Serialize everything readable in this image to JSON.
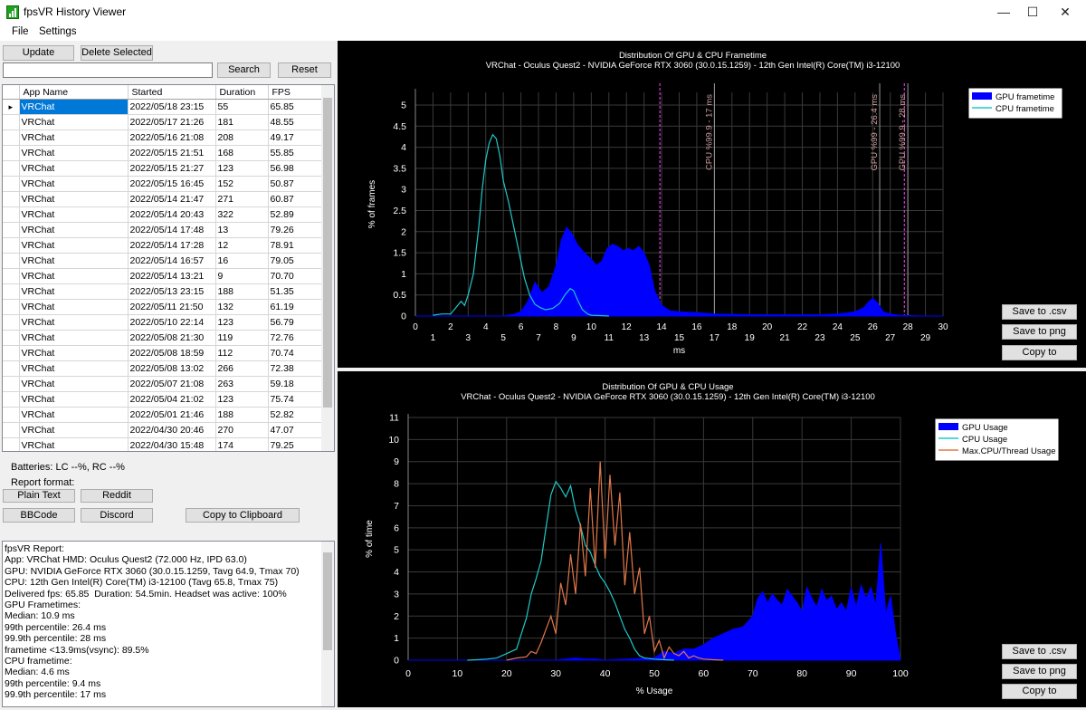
{
  "window": {
    "title": "fpsVR History Viewer",
    "minimize_glyph": "—",
    "maximize_glyph": "☐",
    "close_glyph": "✕"
  },
  "menu": [
    "File",
    "Settings"
  ],
  "toolbar": {
    "update": "Update",
    "delete_selected": "Delete Selected",
    "search": "Search",
    "reset": "Reset",
    "search_value": ""
  },
  "table": {
    "columns": [
      "App Name",
      "Started",
      "Duration",
      "FPS"
    ],
    "rows": [
      [
        "VRChat",
        "2022/05/18 23:15",
        "55",
        "65.85"
      ],
      [
        "VRChat",
        "2022/05/17 21:26",
        "181",
        "48.55"
      ],
      [
        "VRChat",
        "2022/05/16 21:08",
        "208",
        "49.17"
      ],
      [
        "VRChat",
        "2022/05/15 21:51",
        "168",
        "55.85"
      ],
      [
        "VRChat",
        "2022/05/15 21:27",
        "123",
        "56.98"
      ],
      [
        "VRChat",
        "2022/05/15 16:45",
        "152",
        "50.87"
      ],
      [
        "VRChat",
        "2022/05/14 21:47",
        "271",
        "60.87"
      ],
      [
        "VRChat",
        "2022/05/14 20:43",
        "322",
        "52.89"
      ],
      [
        "VRChat",
        "2022/05/14 17:48",
        "13",
        "79.26"
      ],
      [
        "VRChat",
        "2022/05/14 17:28",
        "12",
        "78.91"
      ],
      [
        "VRChat",
        "2022/05/14 16:57",
        "16",
        "79.05"
      ],
      [
        "VRChat",
        "2022/05/14 13:21",
        "9",
        "70.70"
      ],
      [
        "VRChat",
        "2022/05/13 23:15",
        "188",
        "51.35"
      ],
      [
        "VRChat",
        "2022/05/11 21:50",
        "132",
        "61.19"
      ],
      [
        "VRChat",
        "2022/05/10 22:14",
        "123",
        "56.79"
      ],
      [
        "VRChat",
        "2022/05/08 21:30",
        "119",
        "72.76"
      ],
      [
        "VRChat",
        "2022/05/08 18:59",
        "112",
        "70.74"
      ],
      [
        "VRChat",
        "2022/05/08 13:02",
        "266",
        "72.38"
      ],
      [
        "VRChat",
        "2022/05/07 21:08",
        "263",
        "59.18"
      ],
      [
        "VRChat",
        "2022/05/04 21:02",
        "123",
        "75.74"
      ],
      [
        "VRChat",
        "2022/05/01 21:46",
        "188",
        "52.82"
      ],
      [
        "VRChat",
        "2022/04/30 20:46",
        "270",
        "47.07"
      ],
      [
        "VRChat",
        "2022/04/30 15:48",
        "174",
        "79.25"
      ]
    ],
    "selected_row": 0,
    "row_pointer": "▸"
  },
  "batteries": "Batteries: LC --%, RC --%",
  "report_format": {
    "label": "Report format:",
    "plain_text": "Plain Text",
    "reddit": "Reddit",
    "bbcode": "BBCode",
    "discord": "Discord",
    "copy_to_clipboard": "Copy to Clipboard"
  },
  "report": [
    "fpsVR Report:",
    "App: VRChat HMD: Oculus Quest2 (72.000 Hz, IPD 63.0)",
    "GPU: NVIDIA GeForce RTX 3060 (30.0.15.1259, Tavg 64.9, Tmax 70) CPU: 12th Gen Intel(R) Core(TM) i3-12100 (Tavg 65.8, Tmax 75)",
    "Delivered fps: 65.85  Duration: 54.5min. Headset was active: 100%",
    "GPU Frametimes:",
    "Median: 10.9 ms",
    "99th percentile: 26.4 ms",
    "99.9th percentile: 28 ms",
    "frametime <13.9ms(vsync): 89.5%",
    "CPU frametime:",
    "Median: 4.6 ms",
    "99th percentile: 9.4 ms",
    "99.9th percentile: 17 ms"
  ],
  "side_buttons": {
    "save_csv": "Save to .csv",
    "save_png": "Save to png",
    "copy_to": "Copy to"
  },
  "colors": {
    "gpu": "#0000ff",
    "cpu": "#1fc9c9",
    "thread": "#e0784a",
    "marker_cpu": "#a0a0a0",
    "marker_gpu": "#9a9a9a",
    "marker_gpu999": "#ff33ff",
    "vsync": "#ff44ff",
    "selection": "#0078d7"
  },
  "chart_data": [
    {
      "type": "area",
      "title": "Distribution Of GPU & CPU Frametime",
      "subtitle": "VRChat - Oculus Quest2 - NVIDIA GeForce RTX 3060 (30.0.15.1259) - 12th Gen Intel(R) Core(TM) i3-12100",
      "xlabel": "ms",
      "ylabel": "% of frames",
      "xlim": [
        0,
        30
      ],
      "ylim": [
        0,
        5.3
      ],
      "x_ticks_top": [
        0,
        2,
        4,
        6,
        8,
        10,
        12,
        14,
        16,
        18,
        20,
        22,
        24,
        26,
        28,
        30
      ],
      "x_ticks_bottom": [
        1,
        3,
        5,
        7,
        9,
        11,
        13,
        15,
        17,
        19,
        21,
        23,
        25,
        27,
        29
      ],
      "y_ticks": [
        0,
        0.5,
        1,
        1.5,
        2,
        2.5,
        3,
        3.5,
        4,
        4.5,
        5
      ],
      "grid": true,
      "legend": "top-right",
      "series": [
        {
          "name": "GPU frametime",
          "style": "area",
          "x": [
            0,
            1,
            2,
            3,
            4,
            5,
            5.6,
            6,
            6.4,
            6.8,
            7.2,
            7.6,
            8,
            8.3,
            8.6,
            8.9,
            9.2,
            9.6,
            10,
            10.3,
            10.6,
            10.9,
            11.2,
            11.5,
            11.8,
            12.1,
            12.4,
            12.7,
            13,
            13.3,
            13.6,
            14,
            14.5,
            15,
            16,
            17,
            18,
            19,
            20,
            21,
            22,
            23,
            24,
            24.5,
            25,
            25.5,
            25.8,
            26,
            26.3,
            26.6,
            27,
            27.5,
            28,
            29,
            30
          ],
          "values": [
            0,
            0,
            0,
            0,
            0,
            0,
            0.04,
            0.1,
            0.35,
            0.8,
            0.55,
            0.7,
            1.2,
            1.8,
            2.1,
            1.95,
            1.7,
            1.5,
            1.35,
            1.2,
            1.3,
            1.6,
            1.7,
            1.65,
            1.55,
            1.6,
            1.55,
            1.65,
            1.5,
            1.2,
            0.6,
            0.25,
            0.12,
            0.1,
            0.08,
            0.05,
            0.04,
            0.03,
            0.03,
            0.03,
            0.03,
            0.03,
            0.05,
            0.07,
            0.1,
            0.2,
            0.35,
            0.42,
            0.3,
            0.1,
            0.05,
            0.02,
            0.01,
            0,
            0
          ]
        },
        {
          "name": "CPU frametime",
          "style": "line",
          "x": [
            1,
            1.5,
            2,
            2.3,
            2.6,
            2.8,
            3,
            3.3,
            3.6,
            3.8,
            4,
            4.2,
            4.4,
            4.6,
            4.8,
            5,
            5.3,
            5.6,
            5.9,
            6.2,
            6.5,
            6.8,
            7.1,
            7.4,
            7.8,
            8.2,
            8.5,
            8.8,
            9,
            9.2,
            9.5,
            9.8,
            10,
            10.5,
            11
          ],
          "values": [
            0.02,
            0.05,
            0.05,
            0.2,
            0.35,
            0.25,
            0.5,
            1.0,
            2.1,
            3.0,
            3.7,
            4.1,
            4.3,
            4.2,
            3.8,
            3.2,
            2.7,
            2.1,
            1.5,
            0.9,
            0.5,
            0.28,
            0.2,
            0.15,
            0.18,
            0.3,
            0.5,
            0.65,
            0.6,
            0.4,
            0.15,
            0.05,
            0.02,
            0.01,
            0
          ]
        }
      ],
      "markers": [
        {
          "x": 13.9,
          "label": "",
          "style": "vsync"
        },
        {
          "x": 17,
          "label": "CPU %99.9 - 17 ms"
        },
        {
          "x": 26.4,
          "label": "GPU %99 - 26.4 ms"
        },
        {
          "x": 27.8,
          "label": "",
          "style": "vsync"
        },
        {
          "x": 28,
          "label": "GPU %99.9 - 28 ms"
        }
      ]
    },
    {
      "type": "area",
      "title": "Distribution Of GPU & CPU Usage",
      "subtitle": "VRChat - Oculus Quest2 - NVIDIA GeForce RTX 3060 (30.0.15.1259) - 12th Gen Intel(R) Core(TM) i3-12100",
      "xlabel": "% Usage",
      "ylabel": "% of time",
      "xlim": [
        0,
        100
      ],
      "ylim": [
        0,
        11
      ],
      "x_ticks": [
        0,
        10,
        20,
        30,
        40,
        50,
        60,
        70,
        80,
        90,
        100
      ],
      "y_ticks": [
        0,
        1,
        2,
        3,
        4,
        5,
        6,
        7,
        8,
        9,
        10,
        11
      ],
      "grid": true,
      "legend": "top-right",
      "series": [
        {
          "name": "GPU Usage",
          "style": "area",
          "x": [
            0,
            10,
            20,
            25,
            30,
            32,
            34,
            36,
            38,
            40,
            45,
            50,
            52,
            54,
            56,
            58,
            60,
            62,
            64,
            66,
            68,
            70,
            71,
            72,
            73,
            74,
            75,
            76,
            77,
            78,
            79,
            80,
            81,
            82,
            83,
            84,
            85,
            86,
            87,
            88,
            89,
            90,
            91,
            92,
            93,
            94,
            95,
            96,
            97,
            98,
            99,
            100
          ],
          "values": [
            0,
            0,
            0,
            0,
            0,
            0.05,
            0.1,
            0.05,
            0.05,
            0,
            0.05,
            0.1,
            0.4,
            0.3,
            0.5,
            0.5,
            0.7,
            1.0,
            1.2,
            1.4,
            1.5,
            2.0,
            2.8,
            3.1,
            2.6,
            3.0,
            2.7,
            2.5,
            3.2,
            2.9,
            2.6,
            2.2,
            3.3,
            2.8,
            2.4,
            3.2,
            2.7,
            2.9,
            2.3,
            2.6,
            2.2,
            3.3,
            2.4,
            3.4,
            2.8,
            3.3,
            2.5,
            5.3,
            2.1,
            2.9,
            1.2,
            0
          ]
        },
        {
          "name": "CPU Usage",
          "style": "line",
          "x": [
            12,
            14,
            16,
            18,
            20,
            22,
            23,
            24,
            25,
            26,
            27,
            28,
            29,
            30,
            31,
            32,
            33,
            34,
            35,
            36,
            37,
            38,
            39,
            40,
            41,
            42,
            43,
            44,
            45,
            46,
            47,
            48,
            50,
            52,
            54
          ],
          "values": [
            0,
            0.02,
            0.05,
            0.1,
            0.3,
            0.5,
            1.2,
            1.9,
            3.0,
            3.7,
            4.5,
            6.0,
            7.5,
            8.1,
            7.8,
            7.4,
            7.9,
            6.8,
            6.1,
            5.2,
            4.9,
            4.3,
            3.8,
            3.5,
            3.1,
            2.6,
            2.0,
            1.4,
            1.0,
            0.5,
            0.2,
            0.1,
            0.05,
            0.02,
            0
          ]
        },
        {
          "name": "Max.CPU/Thread Usage",
          "style": "line",
          "x": [
            20,
            22,
            24,
            25,
            26,
            27,
            28,
            29,
            30,
            31,
            32,
            33,
            34,
            35,
            36,
            37,
            38,
            39,
            40,
            41,
            42,
            43,
            44,
            45,
            46,
            47,
            48,
            49,
            50,
            51,
            52,
            53,
            54,
            55,
            56,
            57,
            58,
            59,
            60,
            62,
            64
          ],
          "values": [
            0,
            0.1,
            0.15,
            0.4,
            0.3,
            0.8,
            1.4,
            2.0,
            1.2,
            3.5,
            2.5,
            4.8,
            3.0,
            6.2,
            3.8,
            7.8,
            4.2,
            9.0,
            4.6,
            8.4,
            5.2,
            7.6,
            3.4,
            5.8,
            3.0,
            4.2,
            1.2,
            2.0,
            0.4,
            0.9,
            0.1,
            0.6,
            0.3,
            0.2,
            0.4,
            0.1,
            0.2,
            0.1,
            0.05,
            0.02,
            0
          ]
        }
      ]
    }
  ]
}
